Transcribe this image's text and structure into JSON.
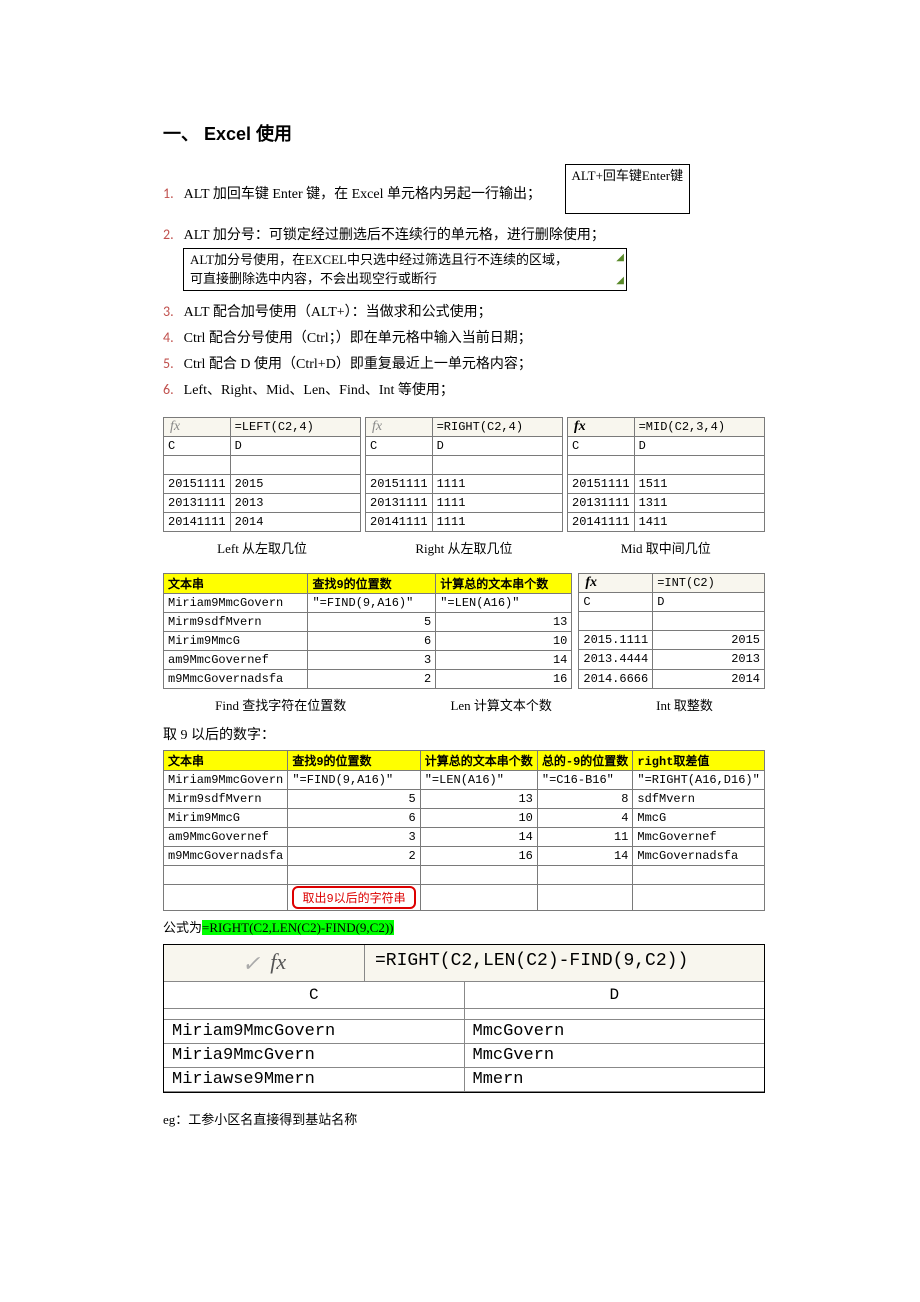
{
  "heading": "一、    Excel 使用",
  "tips": [
    {
      "num": "1.",
      "text": "ALT 加回车键 Enter 键，在 Excel 单元格内另起一行输出；"
    },
    {
      "num": "2.",
      "text": "ALT 加分号：可锁定经过删选后不连续行的单元格，进行删除使用；"
    },
    {
      "num": "3.",
      "text": "ALT 配合加号使用（ALT+）：当做求和公式使用；"
    },
    {
      "num": "4.",
      "text": "Ctrl 配合分号使用（Ctrl；）即在单元格中输入当前日期；"
    },
    {
      "num": "5.",
      "text": "Ctrl 配合 D 使用（Ctrl+D）即重复最近上一单元格内容；"
    },
    {
      "num": "6.",
      "text": "Left、Right、Mid、Len、Find、Int 等使用；"
    }
  ],
  "box1": "ALT+回车键Enter键",
  "box2a": "ALT加分号使用，在EXCEL中只选中经过筛选且行不连续的区域，",
  "box2b": "可直接删除选中内容，不会出现空行或断行",
  "fx": "fx",
  "leftF": "=LEFT(C2,4)",
  "rightF": "=RIGHT(C2,4)",
  "midF": "=MID(C2,3,4)",
  "colC": "C",
  "colD": "D",
  "leftRows": [
    [
      "20151111",
      "2015"
    ],
    [
      "20131111",
      "2013"
    ],
    [
      "20141111",
      "2014"
    ]
  ],
  "rightRows": [
    [
      "20151111",
      "1111"
    ],
    [
      "20131111",
      "1111"
    ],
    [
      "20141111",
      "1111"
    ]
  ],
  "midRows": [
    [
      "20151111",
      "1511"
    ],
    [
      "20131111",
      "1311"
    ],
    [
      "20141111",
      "1411"
    ]
  ],
  "cap1": "Left 从左取几位",
  "cap2": "Right 从左取几位",
  "cap3": "Mid 取中间几位",
  "t2h1": "文本串",
  "t2h2": "查找9的位置数",
  "t2h3": "计算总的文本串个数",
  "findF": "\"=FIND(9,A16)\"",
  "lenF": "\"=LEN(A16)\"",
  "intF": "=INT(C2)",
  "t2rows": [
    [
      "Miriam9MmcGovern",
      "",
      ""
    ],
    [
      "Mirm9sdfMvern",
      "5",
      "13"
    ],
    [
      "Mirim9MmcG",
      "6",
      "10"
    ],
    [
      "am9MmcGovernef",
      "3",
      "14"
    ],
    [
      "m9MmcGovernadsfa",
      "2",
      "16"
    ]
  ],
  "intRows": [
    [
      "2015.1111",
      "2015"
    ],
    [
      "2013.4444",
      "2013"
    ],
    [
      "2014.6666",
      "2014"
    ]
  ],
  "cap4": "Find 查找字符在位置数",
  "cap5": "Len 计算文本个数",
  "cap6": "Int 取整数",
  "line9": "取 9 以后的数字：",
  "t3h4": "总的-9的位置数",
  "t3h5": "right取差值",
  "diffF": "\"=C16-B16\"",
  "rightDF": "\"=RIGHT(A16,D16)\"",
  "t3rows": [
    [
      "Miriam9MmcGovern",
      "",
      "",
      "",
      ""
    ],
    [
      "Mirm9sdfMvern",
      "5",
      "13",
      "8",
      "sdfMvern"
    ],
    [
      "Mirim9MmcG",
      "6",
      "10",
      "4",
      "MmcG"
    ],
    [
      "am9MmcGovernef",
      "3",
      "14",
      "11",
      "MmcGovernef"
    ],
    [
      "m9MmcGovernadsfa",
      "2",
      "16",
      "14",
      "MmcGovernadsfa"
    ]
  ],
  "redbox": "取出9以后的字符串",
  "formulaLabel": "公式为",
  "formulaHL": "=RIGHT(C2,LEN(C2)-FIND(9,C2))",
  "bigF": "=RIGHT(C2,LEN(C2)-FIND(9,C2))",
  "bigRows": [
    [
      "Miriam9MmcGovern",
      "MmcGovern"
    ],
    [
      "Miria9MmcGvern",
      "MmcGvern"
    ],
    [
      "Miriawse9Mmern",
      "Mmern"
    ]
  ],
  "eg": "eg：工参小区名直接得到基站名称"
}
